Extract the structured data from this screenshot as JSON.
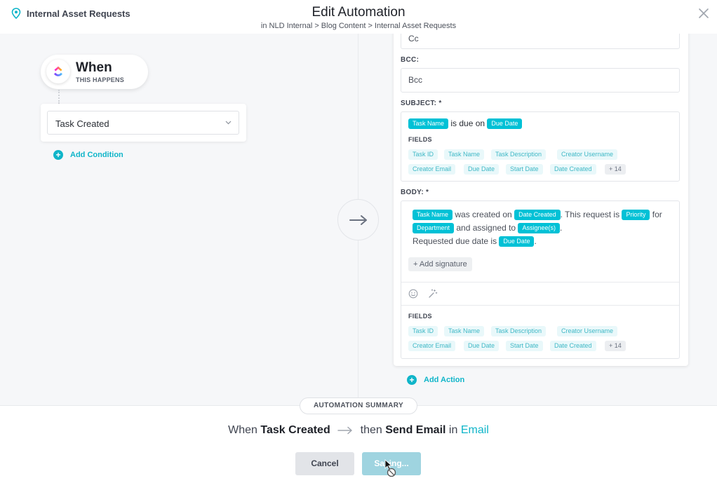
{
  "header": {
    "list_name": "Internal Asset Requests",
    "title": "Edit Automation",
    "breadcrumb": "in NLD Internal > Blog Content > Internal Asset Requests"
  },
  "trigger": {
    "when_label": "When",
    "when_sub": "THIS HAPPENS",
    "selected": "Task Created",
    "add_condition": "Add Condition"
  },
  "action": {
    "cc_placeholder": "Cc",
    "bcc_label": "BCC:",
    "bcc_placeholder": "Bcc",
    "subject_label": "SUBJECT: *",
    "subject": {
      "tag1": "Task Name",
      "text1": " is due on ",
      "tag2": "Due Date"
    },
    "fields_label": "FIELDS",
    "field_tags": [
      "Task ID",
      "Task Name",
      "Task Description",
      "Creator Username",
      "Creator Email",
      "Due Date",
      "Start Date",
      "Date Created",
      "+ 14"
    ],
    "body_label": "BODY: *",
    "body": {
      "t1": "Task Name",
      "s1": " was created on ",
      "t2": "Date Created",
      "s2": ". This request is ",
      "t3": "Priority",
      "s3": " for ",
      "t4": "Department",
      "s4": " and assigned to ",
      "t5": "Assignee(s)",
      "s5": ".",
      "s6": "Requested due date is ",
      "t6": "Due Date",
      "s7": "."
    },
    "add_signature": "+ Add signature",
    "add_action": "Add Action"
  },
  "footer": {
    "summary_label": "AUTOMATION SUMMARY",
    "when": "When",
    "trigger": "Task Created",
    "then": "then",
    "action": "Send Email",
    "in": "in",
    "target": "Email",
    "cancel": "Cancel",
    "save": "Saving..."
  },
  "colors": {
    "accent": "#00c1d6",
    "link": "#0fb5c9",
    "save_disabled": "#9fd4e0"
  }
}
